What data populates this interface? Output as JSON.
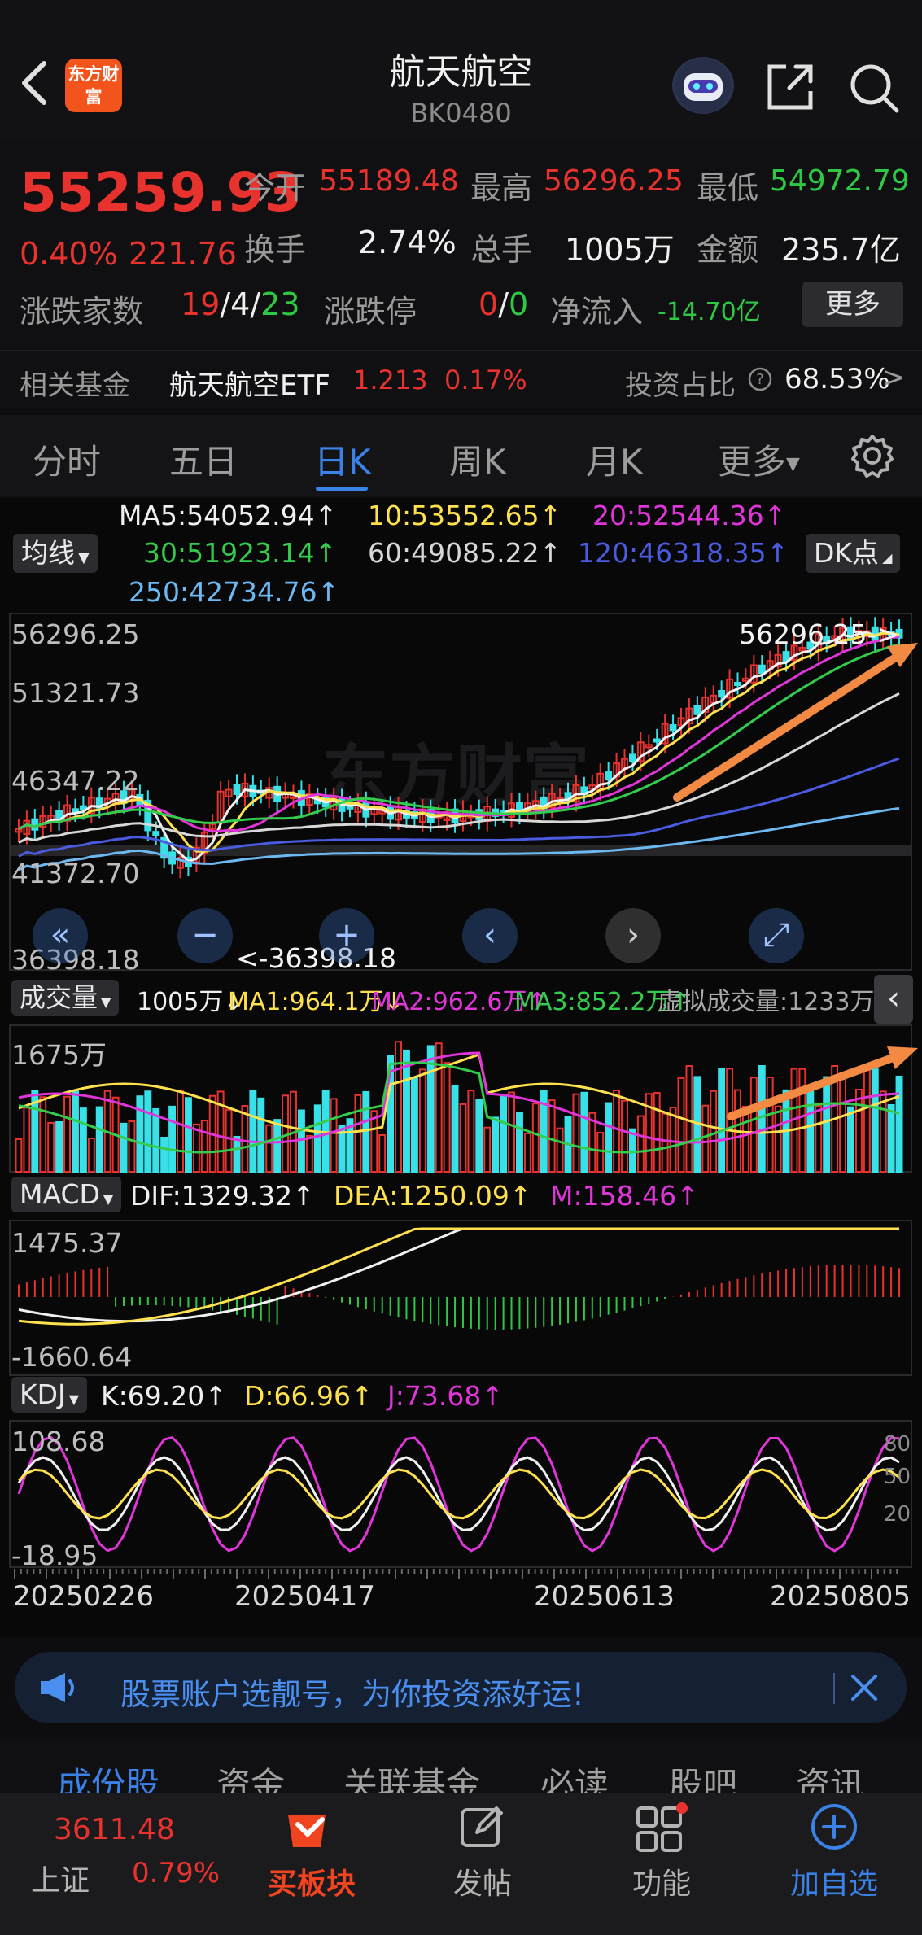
{
  "header": {
    "logo": "东方财富",
    "title": "航天航空",
    "code": "BK0480"
  },
  "quote": {
    "price": "55259.93",
    "change_pct": "0.40%",
    "change_abs": "221.76",
    "open_label": "今开",
    "open": "55189.48",
    "high_label": "最高",
    "high": "56296.25",
    "low_label": "最低",
    "low": "54972.79",
    "turnover_label": "换手",
    "turnover": "2.74%",
    "volume_label": "总手",
    "volume": "1005万",
    "amount_label": "金额",
    "amount": "235.7亿",
    "breadth_label": "涨跌家数",
    "up": "19",
    "sep1": "/",
    "flat": "4",
    "sep2": "/",
    "down": "23",
    "limit_label": "涨跌停",
    "limit_up": "0",
    "limit_sep": "/",
    "limit_down": "0",
    "netflow_label": "净流入",
    "netflow": "-14.70亿",
    "more": "更多"
  },
  "fund": {
    "label": "相关基金",
    "name": "航天航空ETF",
    "price": "1.213",
    "pct": "0.17%",
    "ratio_label": "投资占比",
    "ratio": "68.53%",
    "arrow": ">"
  },
  "tabs": [
    "分时",
    "五日",
    "日K",
    "周K",
    "月K",
    "更多"
  ],
  "active_tab": 2,
  "ma": {
    "selector": "均线",
    "ma5": "MA5:54052.94↑",
    "ma10": "10:53552.65↑",
    "ma20": "20:52544.36↑",
    "ma30": "30:51923.14↑",
    "ma60": "60:49085.22↑",
    "ma120": "120:46318.35↑",
    "ma250": "250:42734.76↑",
    "dk": "DK点"
  },
  "price_axis": [
    "56296.25",
    "51321.73",
    "46347.22",
    "41372.70",
    "36398.18"
  ],
  "price_annot": {
    "high": "56296.25->",
    "low": "<-36398.18"
  },
  "volume": {
    "selector": "成交量",
    "vol": "1005万↓",
    "ma1": "MA1:964.1万↓",
    "ma2": "MA2:962.6万↑",
    "ma3": "MA3:852.2万↑",
    "virtual": "虚拟成交量:1233万",
    "axis_top": "1675万"
  },
  "macd": {
    "selector": "MACD",
    "dif": "DIF:1329.32↑",
    "dea": "DEA:1250.09↑",
    "m": "M:158.46↑",
    "axis_top": "1475.37",
    "axis_bottom": "-1660.64"
  },
  "kdj": {
    "selector": "KDJ",
    "k": "K:69.20↑",
    "d": "D:66.96↑",
    "j": "J:73.68↑",
    "axis_top": "108.68",
    "axis_bottom": "-18.95",
    "r80": "80",
    "r50": "50",
    "r20": "20"
  },
  "dates": [
    "20250226",
    "20250417",
    "20250613",
    "20250805"
  ],
  "banner": "股票账户选靓号，为你投资添好运!",
  "subtabs": [
    "成份股",
    "资金",
    "关联基金",
    "必读",
    "股吧",
    "资讯"
  ],
  "bottom_nav": {
    "index_value": "3611.48",
    "index_name": "上证",
    "index_pct": "0.79%",
    "buy": "买板块",
    "post": "发帖",
    "func": "功能",
    "add": "加自选"
  },
  "colors": {
    "up": "#e8322e",
    "down": "#2ec845",
    "accent": "#3a82e8",
    "candle_down": "#38e0e8"
  }
}
